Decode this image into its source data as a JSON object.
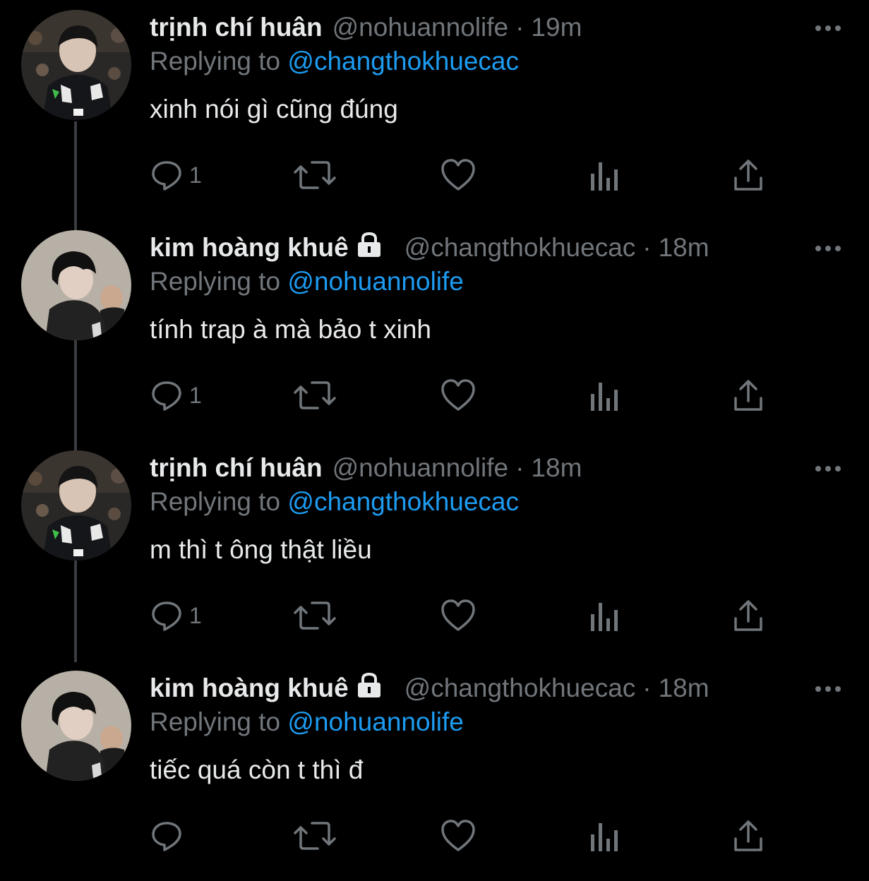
{
  "colors": {
    "background": "#000000",
    "text": "#e7e9ea",
    "muted": "#71767b",
    "link": "#1d9bf0",
    "thread_line": "#3a3d41"
  },
  "icons": {
    "more": "more-horizontal-icon",
    "reply": "reply-icon",
    "retweet": "retweet-icon",
    "like": "heart-icon",
    "analytics": "analytics-icon",
    "share": "share-icon",
    "lock": "lock-icon"
  },
  "tweets": [
    {
      "name": "trịnh chí huân",
      "protected": false,
      "handle": "@nohuannolife",
      "separator": "·",
      "time": "19m",
      "reply_prefix": "Replying to",
      "reply_to": "@changthokhuecac",
      "text": "xinh nói gì cũng đúng",
      "reply_count": "1"
    },
    {
      "name": "kim hoàng khuê",
      "protected": true,
      "handle": "@changthokhuecac",
      "separator": "·",
      "time": "18m",
      "reply_prefix": "Replying to",
      "reply_to": "@nohuannolife",
      "text": "tính trap à mà bảo t xinh",
      "reply_count": "1"
    },
    {
      "name": "trịnh chí huân",
      "protected": false,
      "handle": "@nohuannolife",
      "separator": "·",
      "time": "18m",
      "reply_prefix": "Replying to",
      "reply_to": "@changthokhuecac",
      "text": "m thì t ông thật liều",
      "reply_count": "1"
    },
    {
      "name": "kim hoàng khuê",
      "protected": true,
      "handle": "@changthokhuecac",
      "separator": "·",
      "time": "18m",
      "reply_prefix": "Replying to",
      "reply_to": "@nohuannolife",
      "text": "tiếc quá còn t thì đ",
      "reply_count": ""
    }
  ]
}
